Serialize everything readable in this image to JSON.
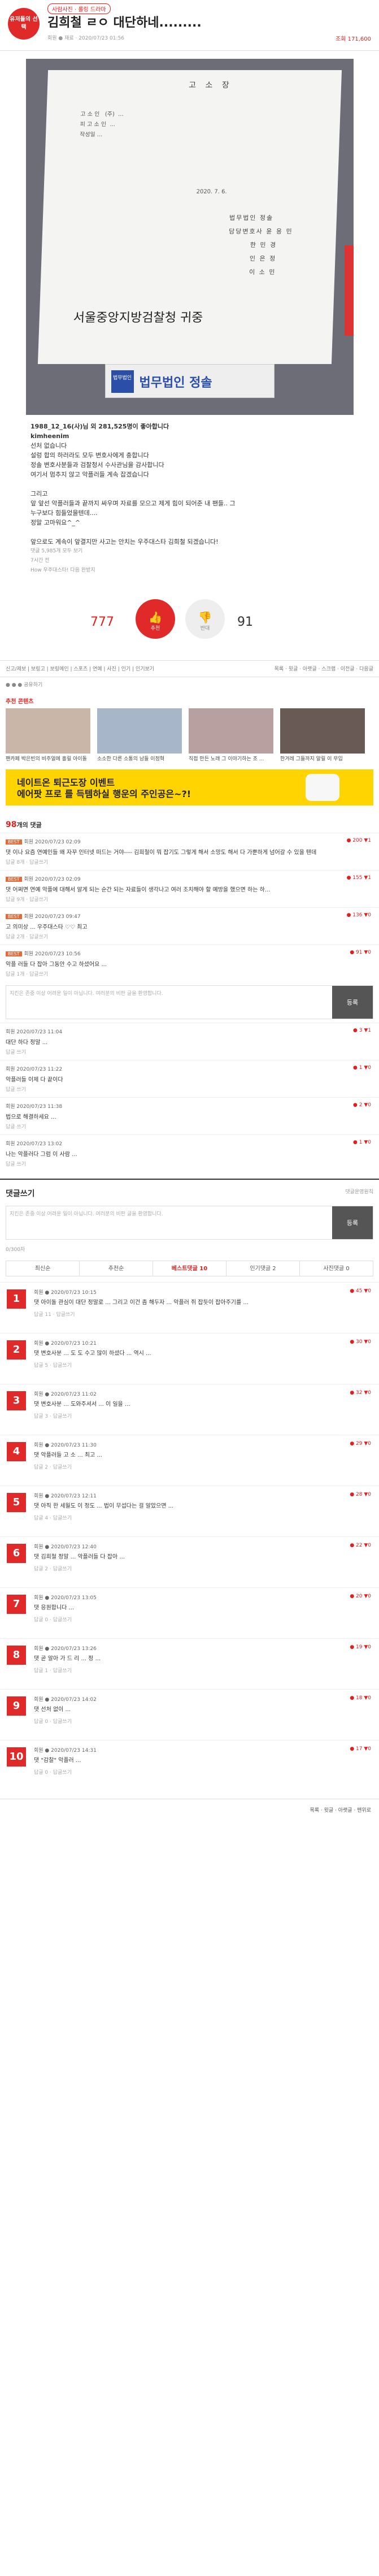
{
  "header": {
    "tag": "사람사진 · 롤링 드라마",
    "badge": "유저들의 선택",
    "title": "김희철 ㄹㅇ 대단하네.........",
    "meta": "회원 ● 재료 · 2020/07/23 01:56",
    "hits": "조회 171,600"
  },
  "photo": {
    "heading": "고 소 장",
    "body": "고 소 인   (주)  ...\n피 고 소 인  ...\n작성일 ...",
    "date": "2020. 7. 6.",
    "signers": "법무법인 정솔\n담당변호사 윤 용 민\n       한 민 경\n       인 은 정\n       이 소 민",
    "court": "서울중앙지방검찰청   귀중",
    "firm": "법무법인 정솔",
    "logo": "법무법인"
  },
  "body": {
    "line1": "1988_12_16(사)님 외 281,525명이 좋아합니다",
    "user": "kimheenim",
    "paras": [
      "선처 없습니다",
      "설렁 합의 하러라도 모두 변호사에게 충합니다",
      "정솔 변호사분들과 검찰청서 수사관님을 감사합니다",
      "여기서 멈추지 않고 악플러들 계속 잡겠습니다",
      "",
      "그리고",
      "앞 앞선 악플러들과 끝까지 싸우며 자료를 모으고 제게 힘이 되어준 내 팬들.. 그",
      "누구보다 힘들었을텐데....",
      "정말 고마워요^_^",
      "",
      "앞으로도 계속이 앞결지만 사고는 안치는 우주대스타 김희철 되겠습니다!"
    ],
    "more": "댓글 5,985개 모두 보기",
    "time": "7시간 전",
    "src": "How 우주대스타! 다음 완받지"
  },
  "vote": {
    "up_count": "777",
    "up_label": "추천",
    "down_count": "91",
    "down_label": "반대"
  },
  "tools": {
    "left": "신고/제보 | 보링고 | 보링메인 | 스포츠 | 연예 | 사진 | 인기 | 인기보기",
    "right": "목록 · 윗글 · 아랫글 · 스크랩 · 이전글 · 다음글"
  },
  "share": "공유하기",
  "rec": {
    "title": "추천 콘텐츠",
    "items": [
      "팬카페 박은빈의 비주얼에 홀릴 아이돌",
      "소소한 다른 소통의 남들 이정혁",
      "직접 만든 노래 그 이야기하는 조 ...",
      "한겨레 그들까지 알릴 이 무입"
    ]
  },
  "ad": {
    "text": "네이트온 퇴근도장 이벤트\n에어팟 프로 를 득템하실 행운의 주인공은~?!"
  },
  "comments": {
    "title": "98",
    "title_suffix": "개의 댓글",
    "items": [
      {
        "nm": "회원  2020/07/23 02:09",
        "tx": "댓 이나 요즘 연예인들 왜 자꾸 인터넷 떠드는 거야---- 김희철이 뭐 잡기도 그렇게 해서 소망도 해서 다 가뿐하게 넘어갈 수 있을 텐데",
        "rp": "답글 8개 · 답글쓰기",
        "vt": "● 200  ▼1",
        "best": "BEST"
      },
      {
        "nm": "회원  2020/07/23 02:09",
        "tx": "댓 어쩌면 연예 악플에 대해서 알게 되는 순간 되는 자료들이 생각나고 여러 조치해야 할 예방을 했으면 하는 하...",
        "rp": "답글 9개 · 답글쓰기",
        "vt": "● 155  ▼1",
        "best": "BEST"
      },
      {
        "nm": "회원  2020/07/23 09:47",
        "tx": "고 의미상 ... 우주대스타 ♡♡ 최고",
        "rp": "답글 2개 · 답글쓰기",
        "vt": "● 136  ▼0",
        "best": "BEST"
      },
      {
        "nm": "회원  2020/07/23 10:56",
        "tx": "악플 러들 다 잡아 그동안 수고 하셨어요 ...",
        "rp": "답글 1개 · 답글쓰기",
        "vt": "● 91  ▼0",
        "best": "BEST"
      },
      {
        "nm": "회원  2020/07/23 11:04",
        "tx": "대단 하다 정말 ...",
        "rp": "답글 쓰기",
        "vt": "● 3  ▼1",
        "best": ""
      },
      {
        "nm": "회원  2020/07/23 11:22",
        "tx": "악플러들 이제 다 끝이다",
        "rp": "답글 쓰기",
        "vt": "● 1  ▼0",
        "best": ""
      },
      {
        "nm": "회원  2020/07/23 11:38",
        "tx": "법으로 해결하세요 ...",
        "rp": "답글 쓰기",
        "vt": "● 2  ▼0",
        "best": ""
      },
      {
        "nm": "회원  2020/07/23 13:02",
        "tx": "나는 악플러다 그럼 이 사람 ...",
        "rp": "답글 쓰기",
        "vt": "● 1  ▼0",
        "best": ""
      }
    ]
  },
  "reply": {
    "placeholder": "지킨은 존중 이상 어려운 일이 아닙니다. 여러분의 비판 글을 환영합니다.",
    "btn": "등록",
    "count": "0/300자"
  },
  "write": {
    "title": "댓글쓰기",
    "sub": "댓글운영원칙"
  },
  "tabs": [
    "최신순",
    "추천순",
    "베스트댓글 10",
    "인기댓글 2",
    "사진댓글 0"
  ],
  "ranks": [
    {
      "num": "1",
      "nm": "회원 ● 2020/07/23 10:15",
      "tx": "댓 아이돌 관심이 대단 정말로 ... 그리고 이건 좀 해두자 ... 악플러 쥐 잡듯이 잡아주기를 ...",
      "rp": "답글 11 · 답글쓰기",
      "vt": "● 45  ▼0"
    },
    {
      "num": "2",
      "nm": "회원 ● 2020/07/23 10:21",
      "tx": "댓 변호사분 ... 도 도 수고 많이 하셨다 ... 역시 ...",
      "rp": "답글 5 · 답글쓰기",
      "vt": "● 30  ▼0"
    },
    {
      "num": "3",
      "nm": "회원 ● 2020/07/23 11:02",
      "tx": "댓 변호사분 ... 도와주셔서 ... 이 일을 ...",
      "rp": "답글 3 · 답글쓰기",
      "vt": "● 32  ▼0"
    },
    {
      "num": "4",
      "nm": "회원 ● 2020/07/23 11:30",
      "tx": "댓 악플러들 고 소 ... 최고 ...",
      "rp": "답글 2 · 답글쓰기",
      "vt": "● 29  ▼0"
    },
    {
      "num": "5",
      "nm": "회원 ● 2020/07/23 12:11",
      "tx": "댓 아직 한 세월도 이 정도 ... 법이 무섭다는 걸 알았으면 ...",
      "rp": "답글 4 · 답글쓰기",
      "vt": "● 28  ▼0"
    },
    {
      "num": "6",
      "nm": "회원 ● 2020/07/23 12:40",
      "tx": "댓 김희철 정말 ... 악플러들 다 잡아 ...",
      "rp": "답글 2 · 답글쓰기",
      "vt": "● 22  ▼0"
    },
    {
      "num": "7",
      "nm": "회원 ● 2020/07/23 13:05",
      "tx": "댓 응원합니다 ...",
      "rp": "답글 0 · 답글쓰기",
      "vt": "● 20  ▼0"
    },
    {
      "num": "8",
      "nm": "회원 ● 2020/07/23 13:26",
      "tx": "댓 곧 알아 가 드 리 ... 정 ...",
      "rp": "답글 1 · 답글쓰기",
      "vt": "● 19  ▼0"
    },
    {
      "num": "9",
      "nm": "회원 ● 2020/07/23 14:02",
      "tx": "댓 선처 없이 ...",
      "rp": "답글 0 · 답글쓰기",
      "vt": "● 18  ▼0"
    },
    {
      "num": "10",
      "nm": "회원 ● 2020/07/23 14:31",
      "tx": "댓 \"감찰\" 악플러 ...",
      "rp": "답글 0 · 답글쓰기",
      "vt": "● 17  ▼0"
    }
  ],
  "footer": "목록 · 윗글 · 아랫글 · 맨위로"
}
